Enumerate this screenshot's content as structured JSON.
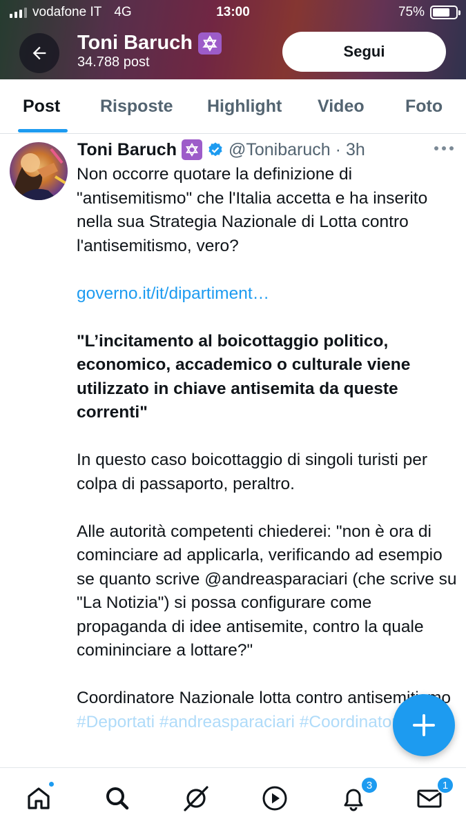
{
  "status_bar": {
    "carrier": "vodafone IT",
    "network": "4G",
    "time": "13:00",
    "battery": "75%",
    "battery_level": 0.75
  },
  "header": {
    "name": "Toni Baruch",
    "post_count": "34.788 post",
    "follow_label": "Segui",
    "back_icon": "arrow-left-icon",
    "name_badge": "star-of-david-icon"
  },
  "tabs": [
    {
      "label": "Post",
      "active": true
    },
    {
      "label": "Risposte",
      "active": false
    },
    {
      "label": "Highlight",
      "active": false
    },
    {
      "label": "Video",
      "active": false
    },
    {
      "label": "Foto",
      "active": false
    }
  ],
  "tweet": {
    "author": "Toni Baruch",
    "handle": "@Tonibaruch",
    "separator": "·",
    "time": "3h",
    "verified": true,
    "paragraphs": [
      "Non occorre quotare la definizione di \"antisemitismo\" che l'Italia accetta e ha inserito nella sua Strategia Nazionale di Lotta contro l'antisemitismo, vero?",
      "governo.it/it/dipartiment…",
      "\"L’incitamento al boicottaggio politico, economico, accademico o culturale viene utilizzato in chiave antisemita da queste correnti\"",
      "In questo caso boicottaggio di singoli turisti per colpa di passaporto, peraltro.",
      "Alle autorità competenti chiederei: \"non è ora di cominciare ad applicarla, verificando ad esempio se quanto scrive @andreasparaciari (che scrive su \"La Notizia\") si possa configurare come propaganda di idee antisemite, contro la quale comininciare a lottare?\"",
      "Coordinatore Nazionale lotta contro antisemitismo"
    ],
    "trailing_text": "#Deportati #andreasparaciari #Coordinatore"
  },
  "bottom_nav": {
    "items": [
      {
        "icon": "home-icon",
        "badge": ""
      },
      {
        "icon": "search-icon",
        "badge": ""
      },
      {
        "icon": "grok-icon",
        "badge": ""
      },
      {
        "icon": "play-icon",
        "badge": ""
      },
      {
        "icon": "bell-icon",
        "badge": "3"
      },
      {
        "icon": "mail-icon",
        "badge": "1"
      }
    ]
  },
  "colors": {
    "accent": "#1d9bf0",
    "text": "#0f1419",
    "muted": "#536471",
    "badge_purple": "#9d5cc9"
  }
}
